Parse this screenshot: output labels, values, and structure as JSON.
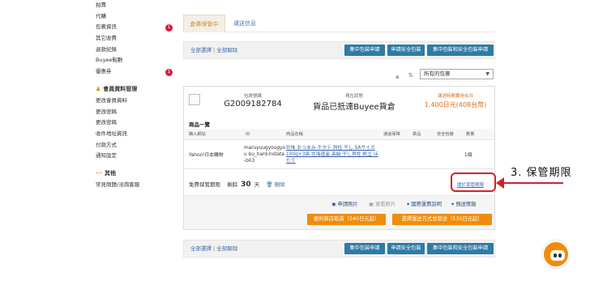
{
  "sidebar": {
    "items": [
      {
        "label": "拍賣",
        "badge": ""
      },
      {
        "label": "代購",
        "badge": ""
      },
      {
        "label": "包裹資訊",
        "badge": "1"
      },
      {
        "label": "其它收費",
        "badge": ""
      },
      {
        "label": "退款紀錄",
        "badge": ""
      },
      {
        "label": "Buyee點數",
        "badge": ""
      },
      {
        "label": "優惠券",
        "badge": "1"
      }
    ],
    "member_section": "會員資料管理",
    "member_items": [
      "更改會員資料",
      "更改密碼",
      "更改密碼",
      "收件地址資訊",
      "付款方式",
      "通知設定"
    ],
    "other_section": "其他",
    "other_items": [
      "常見問題/洽詢客服"
    ]
  },
  "tabs": {
    "active": "倉庫保管中",
    "inactive": "運送信息"
  },
  "selection": {
    "select_all": "全部選擇",
    "separator": "|",
    "deselect_all": "全部解除"
  },
  "bulk_buttons": {
    "consolidate": "集中包裝申請",
    "safe_pack": "申請安全包裝",
    "both": "集中包裝和安全包裝申請"
  },
  "filter": {
    "selected": "所有的包裹"
  },
  "package": {
    "no_label": "包裹號碼",
    "no_value": "G2009182784",
    "status_label": "現在狀態",
    "status_value": "貨品已抵達Buyee貨倉",
    "price_label": "運送時間費用合共",
    "price_value": "1,400日元(408台幣)"
  },
  "products": {
    "title": "商品一覽",
    "headers": [
      "購入網站",
      "ID",
      "商品名稱",
      "通過保障",
      "禁品",
      "安全包裝",
      "數量"
    ],
    "rows": [
      {
        "site": "Yahoo!日本購物",
        "id": "maruyuugyougyou bu_hard-hotate-b03",
        "name": "珍味 おつまみ ホタテ 貝柱 干し SAサイズ 100g×3袋 北海道産 高級 干し貝柱 帆立 ほたて",
        "qty": "1個"
      }
    ]
  },
  "storage": {
    "label": "免費保管期限",
    "remaining": "剩餘",
    "days": "30",
    "unit": "天",
    "delete": "刪除",
    "link": "關於保管期限"
  },
  "tools": {
    "photo": "申請照片",
    "view_photo": "查看照片",
    "intl_guide": "國際運費說明",
    "ship_info": "預送情報"
  },
  "actions": {
    "store_pickup": "便利商店取貨（240日元起）",
    "choose_shipping": "選擇運送方式並發送（530日元起）"
  },
  "annotation": {
    "text": "3. 保管期限"
  },
  "colors": {
    "accent_orange": "#f08c0a",
    "button_blue": "#2f7aa6",
    "highlight_red": "#d4202a"
  }
}
